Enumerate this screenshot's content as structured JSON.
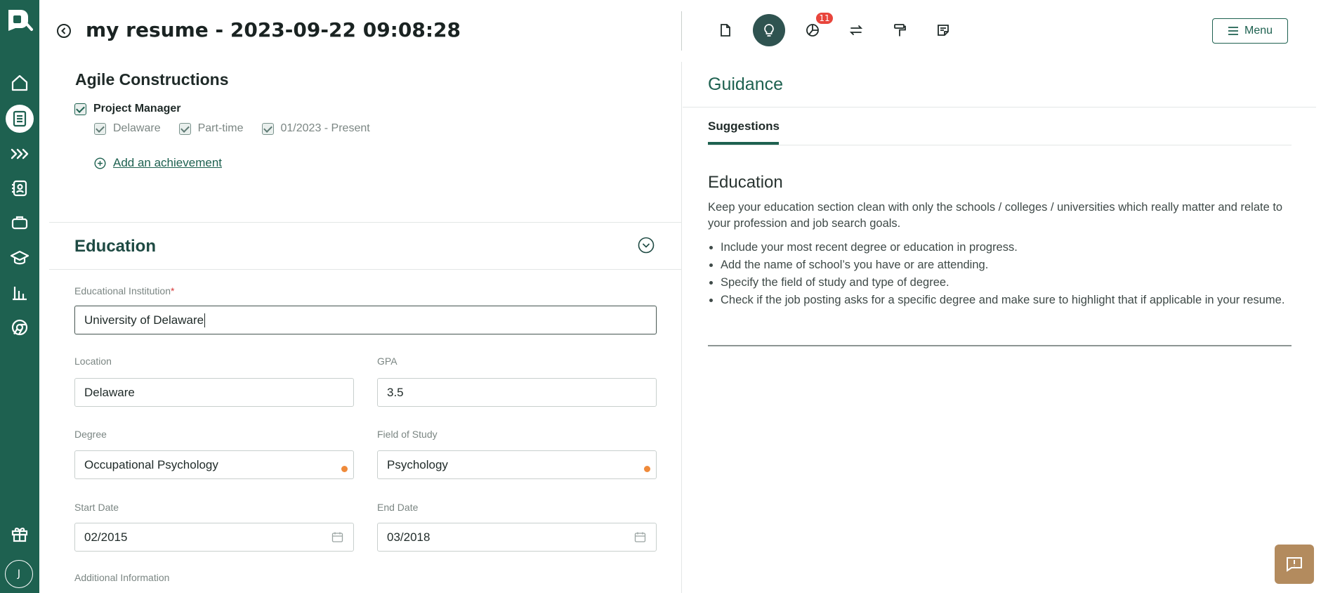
{
  "header": {
    "title": "my resume - 2023-09-22 09:08:28",
    "notification_count": "11",
    "menu_label": "Menu"
  },
  "sidebar": {
    "items": [
      {
        "icon": "home-icon"
      },
      {
        "icon": "document-icon",
        "active": true
      },
      {
        "icon": "chevrons-right-icon"
      },
      {
        "icon": "contact-card-icon"
      },
      {
        "icon": "briefcase-icon"
      },
      {
        "icon": "graduation-cap-icon"
      },
      {
        "icon": "bar-chart-icon"
      },
      {
        "icon": "chrome-icon"
      },
      {
        "icon": "gift-icon"
      }
    ],
    "avatar_initial": "J"
  },
  "experience": {
    "company": "Agile Constructions",
    "job_title": "Project Manager",
    "location": "Delaware",
    "employment_type": "Part-time",
    "dates": "01/2023 - Present",
    "add_achievement": "Add an achievement"
  },
  "education": {
    "section_title": "Education",
    "institution_label": "Educational Institution",
    "institution_required": "*",
    "institution_value": "University of Delaware",
    "location_label": "Location",
    "location_value": "Delaware",
    "gpa_label": "GPA",
    "gpa_value": "3.5",
    "degree_label": "Degree",
    "degree_value": "Occupational Psychology",
    "field_label": "Field of Study",
    "field_value": "Psychology",
    "start_label": "Start Date",
    "start_value": "02/2015",
    "end_label": "End Date",
    "end_value": "03/2018",
    "additional_label": "Additional Information"
  },
  "guidance": {
    "title": "Guidance",
    "tab": "Suggestions",
    "heading": "Education",
    "intro": "Keep your education section clean with only the schools / colleges / universities which really matter and relate to your profession and job search goals.",
    "tips": [
      "Include your most recent degree or education in progress.",
      "Add the name of school’s you have or are attending.",
      "Specify the field of study and type of degree.",
      "Check if the job posting asks for a specific degree and make sure to highlight that if applicable in your resume."
    ]
  },
  "colors": {
    "brand": "#1e6150",
    "badge": "#e8453c",
    "warning_dot": "#ef8a3a",
    "feedback": "#b38b5e"
  }
}
